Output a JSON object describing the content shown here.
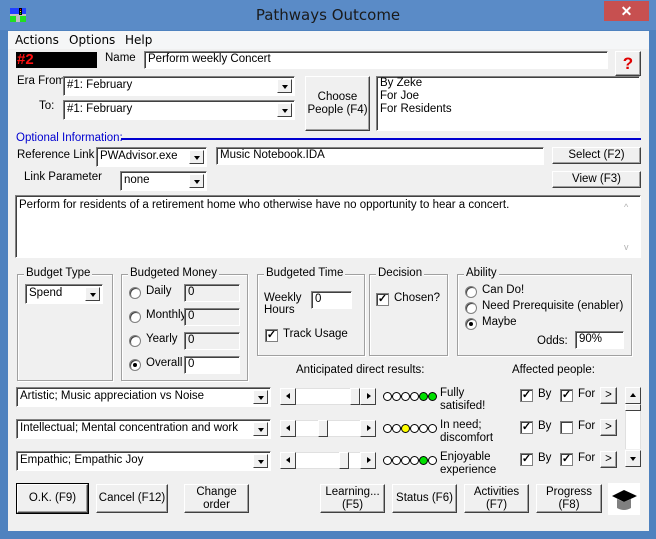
{
  "window": {
    "title": "Pathways Outcome",
    "close_label": "✕"
  },
  "menu": [
    "Actions",
    "Options",
    "Help"
  ],
  "header": {
    "number": "#2",
    "name_label": "Name",
    "name_value": "Perform weekly Concert",
    "help_icon": "?"
  },
  "era": {
    "from_label": "Era From:",
    "from_value": "#1: February",
    "to_label": "To:",
    "to_value": "#1: February"
  },
  "people": {
    "choose_label": "Choose People (F4)",
    "list": [
      "By Zeke",
      "For Joe",
      "For Residents"
    ]
  },
  "optional": {
    "heading": "Optional Information:",
    "reference_link_label": "Reference Link",
    "reference_program": "PWAdvisor.exe",
    "reference_file": "Music Notebook.IDA",
    "select_label": "Select (F2)",
    "link_parameter_label": "Link Parameter",
    "link_parameter_value": "none",
    "view_label": "View (F3)",
    "description": "Perform for residents of a retirement home who otherwise have no opportunity to hear a concert."
  },
  "budget_type": {
    "title": "Budget Type",
    "value": "Spend"
  },
  "budgeted_money": {
    "title": "Budgeted Money",
    "options": [
      {
        "label": "Daily",
        "value": "0",
        "checked": false
      },
      {
        "label": "Monthly",
        "value": "0",
        "checked": false
      },
      {
        "label": "Yearly",
        "value": "0",
        "checked": false
      },
      {
        "label": "Overall",
        "value": "0",
        "checked": true
      }
    ]
  },
  "budgeted_time": {
    "title": "Budgeted Time",
    "weekly_label": "Weekly",
    "hours_label": "Hours",
    "hours_value": "0",
    "track_usage_label": "Track Usage",
    "track_usage_checked": true
  },
  "decision": {
    "title": "Decision",
    "chosen_label": "Chosen?",
    "chosen_checked": true
  },
  "ability": {
    "title": "Ability",
    "options": [
      {
        "label": "Can Do!",
        "checked": false
      },
      {
        "label": "Need Prerequisite (enabler)",
        "checked": false
      },
      {
        "label": "Maybe",
        "checked": true
      }
    ],
    "odds_label": "Odds:",
    "odds_value": "90%"
  },
  "results": {
    "anticipated_label": "Anticipated direct results:",
    "affected_label": "Affected people:",
    "rows": [
      {
        "category": "Artistic; Music appreciation vs Noise",
        "level": 6,
        "max": 6,
        "color": "#00e000",
        "status": "Fully satisifed!",
        "by_checked": true,
        "for_checked": true,
        "by_label": "By",
        "for_label": "For",
        "more": ">"
      },
      {
        "category": "Intellectual; Mental concentration and work",
        "level": 3,
        "max": 6,
        "color": "#ffff00",
        "status": "In need; discomfort",
        "by_checked": true,
        "for_checked": false,
        "by_label": "By",
        "for_label": "For",
        "more": ">"
      },
      {
        "category": "Empathic; Empathic Joy",
        "level": 5,
        "max": 6,
        "color": "#00e000",
        "status": "Enjoyable experience",
        "by_checked": true,
        "for_checked": true,
        "by_label": "By",
        "for_label": "For",
        "more": ">"
      }
    ]
  },
  "footer": {
    "ok_label": "O.K. (F9)",
    "cancel_label": "Cancel (F12)",
    "change_order_label": "Change order",
    "learning_label": "Learning... (F5)",
    "status_label": "Status (F6)",
    "activities_label": "Activities (F7)",
    "progress_label": "Progress (F8)"
  }
}
